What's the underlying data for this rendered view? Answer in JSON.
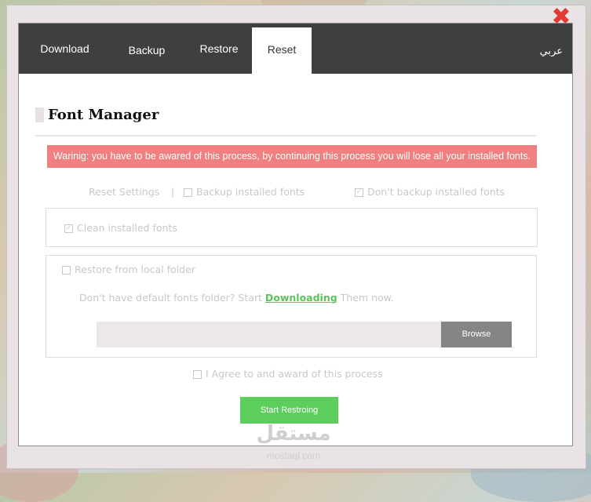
{
  "nav": {
    "tabs": [
      {
        "label": "Download",
        "active": false
      },
      {
        "label": "Backup",
        "active": false
      },
      {
        "label": "Restore",
        "active": false
      },
      {
        "label": "Reset",
        "active": true
      }
    ],
    "language": "عربي"
  },
  "page": {
    "title": "Font Manager",
    "warning": "Warinig: you have to be awared of this process, by continuing this process you will lose all your installed fonts."
  },
  "reset": {
    "settings_label": "Reset Settings",
    "separator": "|",
    "backup_label": "Backup installed fonts",
    "backup_checked": false,
    "no_backup_label": "Don't backup installed fonts",
    "no_backup_checked": true,
    "clean_label": "Clean installed fonts",
    "clean_checked": true,
    "restore_label": "Restore from local folder",
    "restore_checked": false,
    "hint_prefix": "Don't have default fonts folder? Start",
    "hint_link": "Downloading",
    "hint_suffix": "Them now.",
    "folder_value": "",
    "browse_label": "Browse",
    "agree_label": "I Agree to and award of this process",
    "agree_checked": false,
    "start_label": "Start Restroing"
  },
  "watermark": {
    "arabic": "مستقل",
    "latin": "mostaql.com"
  },
  "colors": {
    "nav_bg": "#3f3f3f",
    "warning_bg": "#f08080",
    "accent_green": "#5cce5c",
    "close_red": "#e33a2f"
  },
  "icons": [
    "close-icon",
    "checkbox-icon",
    "checkmark-icon"
  ]
}
